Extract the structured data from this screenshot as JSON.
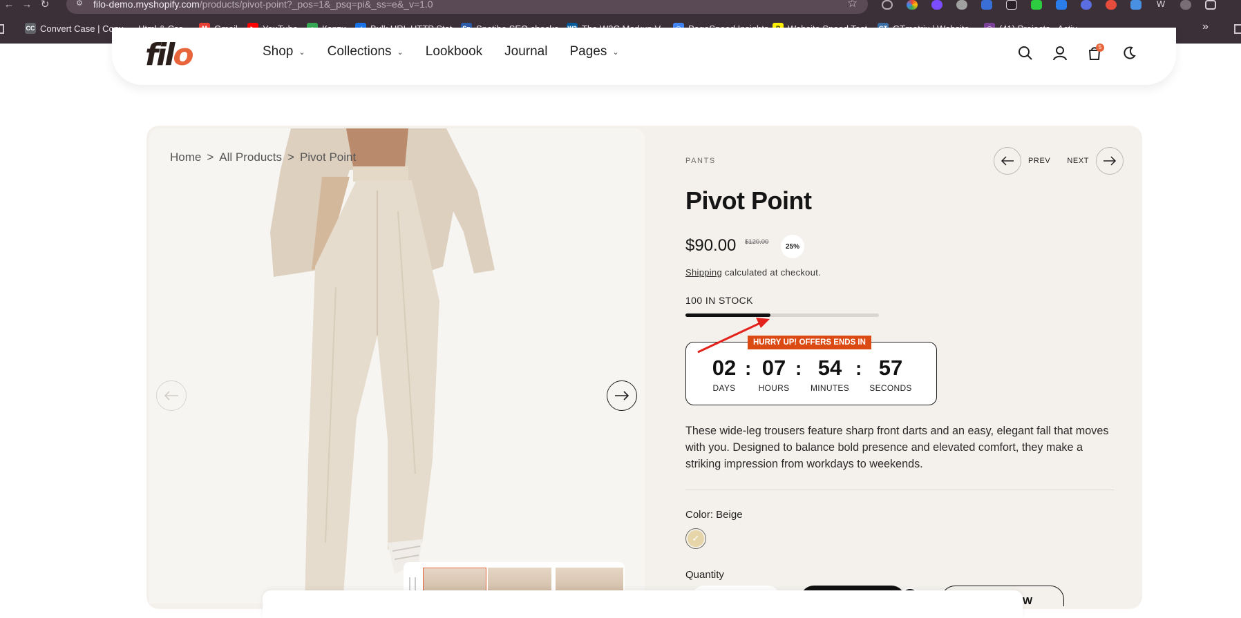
{
  "browser": {
    "url_domain": "filo-demo.myshopify.com",
    "url_path": "/products/pivot-point?_pos=1&_psq=pi&_ss=e&_v=1.0",
    "bookmarks": [
      {
        "label": "Convert Case | Conv...",
        "icon": "convert-case-icon",
        "color": "#5f6368",
        "glyph": "CC"
      },
      {
        "label": "Html & Css",
        "icon": "folder-icon",
        "color": "#3b2f38",
        "glyph": ""
      },
      {
        "label": "Gmail",
        "icon": "gmail-icon",
        "color": "#ea4335",
        "glyph": "M"
      },
      {
        "label": "YouTube",
        "icon": "youtube-icon",
        "color": "#ff0000",
        "glyph": "▶"
      },
      {
        "label": "Карти",
        "icon": "maps-icon",
        "color": "#34a853",
        "glyph": "●"
      },
      {
        "label": "Bulk URL HTTP Stat...",
        "icon": "bulk-url-icon",
        "color": "#1a73e8",
        "glyph": "✓"
      },
      {
        "label": "Spotibo SEO checke...",
        "icon": "spotibo-icon",
        "color": "#2a5caa",
        "glyph": "Sp"
      },
      {
        "label": "The W3C Markup V...",
        "icon": "w3c-icon",
        "color": "#005a9c",
        "glyph": "W3"
      },
      {
        "label": "PageSpeed Insights",
        "icon": "pagespeed-icon",
        "color": "#4285f4",
        "glyph": "◠"
      },
      {
        "label": "Website Speed Test...",
        "icon": "pingdom-icon",
        "color": "#fff000",
        "glyph": "P"
      },
      {
        "label": "GTmetrix | Website...",
        "icon": "gtmetrix-icon",
        "color": "#3a6ea5",
        "glyph": "GT"
      },
      {
        "label": "(41) Projects - Activ...",
        "icon": "projects-icon",
        "color": "#7b4397",
        "glyph": "◎"
      }
    ]
  },
  "header": {
    "logo_part1": "fil",
    "logo_part2": "o",
    "nav": [
      {
        "label": "Shop",
        "has_dropdown": true
      },
      {
        "label": "Collections",
        "has_dropdown": true
      },
      {
        "label": "Lookbook",
        "has_dropdown": false
      },
      {
        "label": "Journal",
        "has_dropdown": false
      },
      {
        "label": "Pages",
        "has_dropdown": true
      }
    ],
    "cart_count": "5"
  },
  "breadcrumb": {
    "items": [
      "Home",
      "All Products",
      "Pivot Point"
    ],
    "separator": ">"
  },
  "product": {
    "category": "PANTS",
    "prev_label": "PREV",
    "next_label": "NEXT",
    "title": "Pivot Point",
    "price": "$90.00",
    "compare_price": "$120.00",
    "discount": "25%",
    "shipping_link": "Shipping",
    "shipping_rest": " calculated at checkout.",
    "stock_text": "100 IN STOCK",
    "stock_fill_fraction": 0.44,
    "countdown": {
      "badge": "HURRY UP! OFFERS ENDS IN",
      "days": "02",
      "hours": "07",
      "minutes": "54",
      "seconds": "57",
      "days_label": "DAYS",
      "hours_label": "HOURS",
      "minutes_label": "MINUTES",
      "seconds_label": "SECONDS",
      "separator": ":"
    },
    "description": "These wide-leg trousers feature sharp front darts and an easy, elegant fall that moves with you. Designed to balance bold presence and elevated comfort, they make a striking impression from workdays to weekends.",
    "color_label": "Color: Beige",
    "swatch_color": "#e5d5a9",
    "quantity_label": "Quantity",
    "buy_button_partial": "W"
  },
  "colors": {
    "accent": "#e8643a",
    "badge": "#dc4a13",
    "card_bg": "#f4f1ec",
    "annotation_arrow": "#e3221b"
  }
}
